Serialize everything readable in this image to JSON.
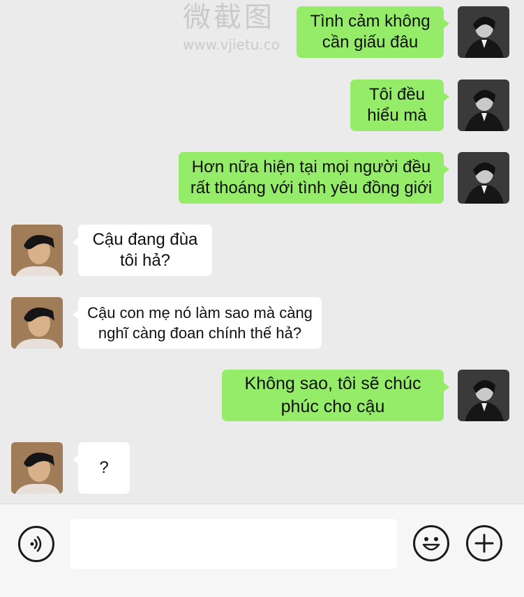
{
  "watermark": {
    "text": "微截图",
    "url": "www.vjietu.co"
  },
  "messages": [
    {
      "side": "sent",
      "text": "Tình cảm không\ncần giấu đâu"
    },
    {
      "side": "sent",
      "text": "Tôi đều\nhiểu mà"
    },
    {
      "side": "sent",
      "text": "Hơn nữa hiện tại mọi người đều\nrất thoáng với tình yêu đồng giới"
    },
    {
      "side": "received",
      "text": "Cậu đang đùa\ntôi hả?"
    },
    {
      "side": "received",
      "text": "Cậu con mẹ nó làm sao mà càng\nnghĩ càng đoan chính thế hả?"
    },
    {
      "side": "sent",
      "text": "Không sao, tôi sẽ chúc\nphúc cho cậu"
    },
    {
      "side": "received",
      "text": "?"
    }
  ],
  "input_bar": {
    "voice_icon": "voice-icon",
    "emoji_icon": "emoji-icon",
    "plus_icon": "plus-icon",
    "message_value": ""
  },
  "colors": {
    "sent_bubble": "#95ec69",
    "received_bubble": "#ffffff",
    "background": "#ebebeb"
  }
}
